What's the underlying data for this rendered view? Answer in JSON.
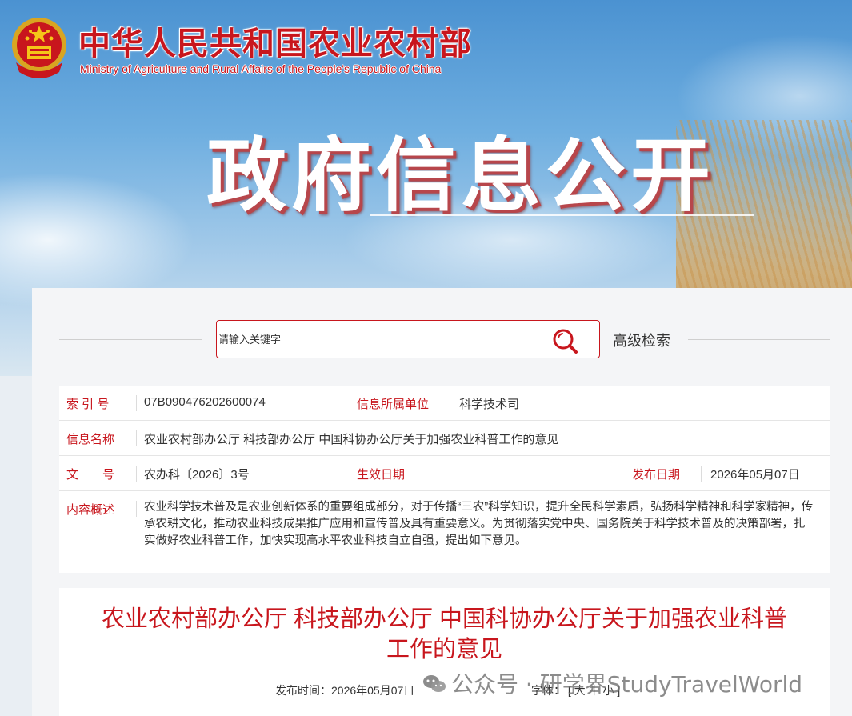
{
  "header": {
    "ministry_cn": "中华人民共和国农业农村部",
    "ministry_en": "Ministry of Agriculture and Rural Affairs of the People's Republic of China",
    "section_title": "政府信息公开"
  },
  "search": {
    "placeholder": "请输入关键字",
    "advanced_label": "高级检索"
  },
  "meta": {
    "index_label": "索 引 号",
    "index_value": "07B090476202600074",
    "dept_label": "信息所属单位",
    "dept_value": "科学技术司",
    "name_label": "信息名称",
    "name_value": "农业农村部办公厅 科技部办公厅 中国科协办公厅关于加强农业科普工作的意见",
    "doc_label": "文　　号",
    "doc_value": "农办科〔2026〕3号",
    "effective_label": "生效日期",
    "effective_value": "",
    "publish_label": "发布日期",
    "publish_value": "2026年05月07日",
    "summary_label": "内容概述",
    "summary_value": "农业科学技术普及是农业创新体系的重要组成部分，对于传播“三农”科学知识，提升全民科学素质，弘扬科学精神和科学家精神，传承农耕文化，推动农业科技成果推广应用和宣传普及具有重要意义。为贯彻落实党中央、国务院关于科学技术普及的决策部署，扎实做好农业科普工作，加快实现高水平农业科技自立自强，提出如下意见。"
  },
  "article": {
    "title": "农业农村部办公厅 科技部办公厅 中国科协办公厅关于加强农业科普工作的意见",
    "publish_time_label": "发布时间：",
    "publish_time_value": "2026年05月07日",
    "font_label": "字体：",
    "font_open": "[",
    "font_large": "大",
    "font_medium": "中",
    "font_small": "小",
    "font_close": "]"
  },
  "watermark": {
    "text": "公众号 · 研学界StudyTravelWorld"
  },
  "colors": {
    "accent": "#c8161d",
    "text": "#333333"
  },
  "icons": {
    "search": "search-icon",
    "emblem": "national-emblem-icon",
    "wechat": "wechat-icon"
  }
}
